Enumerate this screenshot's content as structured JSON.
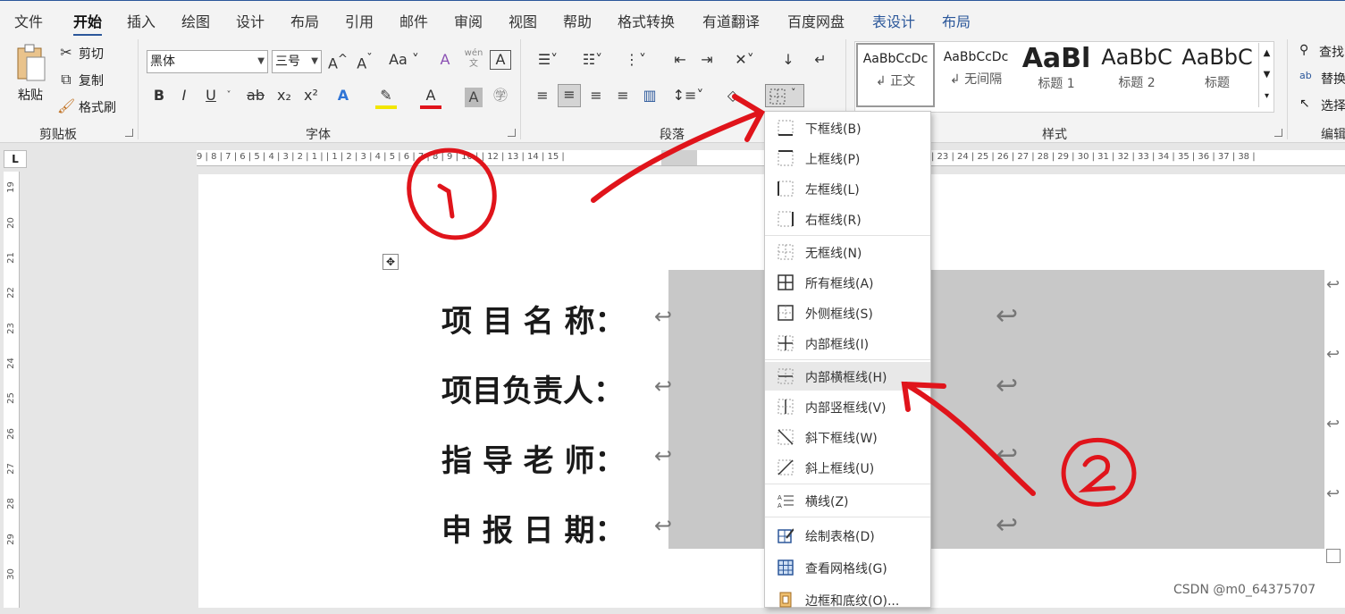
{
  "menubar": {
    "tabs": [
      "文件",
      "开始",
      "插入",
      "绘图",
      "设计",
      "布局",
      "引用",
      "邮件",
      "审阅",
      "视图",
      "帮助",
      "格式转换",
      "有道翻译",
      "百度网盘",
      "表设计",
      "布局"
    ],
    "active": "开始"
  },
  "ribbon": {
    "clipboard": {
      "group": "剪贴板",
      "paste": "粘贴",
      "cut": "剪切",
      "copy": "复制",
      "format_painter": "格式刷"
    },
    "font": {
      "group": "字体",
      "font_name": "黑体",
      "font_size": "三号",
      "grow": "A^",
      "shrink": "Aˇ",
      "case": "Aa",
      "bold": "B",
      "italic": "I",
      "underline": "U",
      "strike": "ab",
      "sub": "x₂",
      "sup": "x²",
      "phonetic": "wén 文"
    },
    "paragraph": {
      "group": "段落"
    },
    "styles": {
      "group": "样式",
      "cards": [
        {
          "preview": "AaBbCcDc",
          "name": "↲ 正文"
        },
        {
          "preview": "AaBbCcDc",
          "name": "↲ 无间隔"
        },
        {
          "preview": "AaBl",
          "name": "标题 1"
        },
        {
          "preview": "AaBbC",
          "name": "标题 2"
        },
        {
          "preview": "AaBbC",
          "name": "标题"
        }
      ]
    },
    "editing": {
      "group": "编辑",
      "find": "查找",
      "replace": "替换",
      "select": "选择"
    }
  },
  "ruler": {
    "h_text": "9 | 8 | 7 | 6 | 5 | 4 | 3 | 2 | 1 |   | 1 | 2 | 3 | 4 | 5 | 6 | 7 | 8 | 9 | 10 |   | 12 | 13 | 14 | 15 |",
    "h_text_right": "| 23 | 24 | 25 | 26 | 27 | 28 | 29 | 30 | 31 | 32 | 33 | 34 | 35 | 36 | 37 | 38 |",
    "v_numbers": [
      "19",
      "20",
      "21",
      "22",
      "23",
      "24",
      "25",
      "26",
      "27",
      "28",
      "29",
      "30"
    ],
    "corner": "L"
  },
  "document": {
    "fields": [
      "项 目 名 称：",
      "项目负责人：",
      "指 导 老 师：",
      "申 报 日 期："
    ]
  },
  "dropdown": {
    "items": [
      {
        "label": "下框线(B)"
      },
      {
        "label": "上框线(P)"
      },
      {
        "label": "左框线(L)"
      },
      {
        "label": "右框线(R)"
      },
      {
        "label": "无框线(N)"
      },
      {
        "label": "所有框线(A)"
      },
      {
        "label": "外侧框线(S)"
      },
      {
        "label": "内部框线(I)"
      },
      {
        "label": "内部横框线(H)"
      },
      {
        "label": "内部竖框线(V)"
      },
      {
        "label": "斜下框线(W)"
      },
      {
        "label": "斜上框线(U)"
      },
      {
        "label": "横线(Z)"
      },
      {
        "label": "绘制表格(D)"
      },
      {
        "label": "查看网格线(G)"
      },
      {
        "label": "边框和底纹(O)..."
      }
    ]
  },
  "watermark": "CSDN @m0_64375707",
  "colors": {
    "accent": "#2b579a",
    "annotation": "#e0141b",
    "table_shade": "#c8c8c8"
  }
}
